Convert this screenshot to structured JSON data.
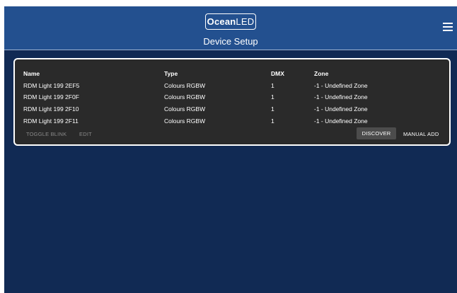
{
  "header": {
    "logo": {
      "part1": "Ocean",
      "part2": "LED"
    },
    "title": "Device Setup"
  },
  "table": {
    "columns": [
      "Name",
      "Type",
      "DMX",
      "Zone"
    ],
    "rows": [
      {
        "name": "RDM Light 199 2EF5",
        "type": "Colours RGBW",
        "dmx": "1",
        "zone": "-1 - Undefined Zone"
      },
      {
        "name": "RDM Light 199 2F0F",
        "type": "Colours RGBW",
        "dmx": "1",
        "zone": "-1 - Undefined Zone"
      },
      {
        "name": "RDM Light 199 2F10",
        "type": "Colours RGBW",
        "dmx": "1",
        "zone": "-1 - Undefined Zone"
      },
      {
        "name": "RDM Light 199 2F11",
        "type": "Colours RGBW",
        "dmx": "1",
        "zone": "-1 - Undefined Zone"
      }
    ]
  },
  "actions": {
    "toggle_blink": "Toggle Blink",
    "edit": "Edit",
    "discover": "Discover",
    "manual_add": "Manual Add"
  },
  "colors": {
    "header": "#23508f",
    "background": "#112a54",
    "panel": "#2a2a2a"
  }
}
